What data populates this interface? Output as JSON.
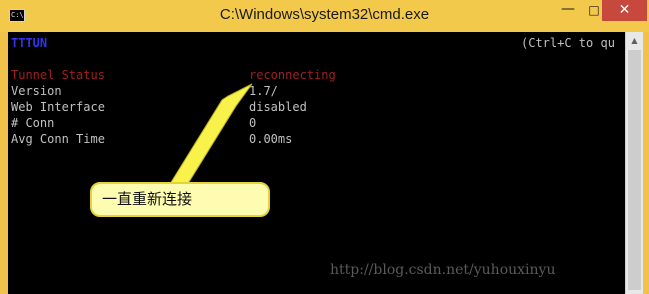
{
  "window": {
    "title": "C:\\Windows\\system32\\cmd.exe",
    "icon_label": "C:\\",
    "controls": {
      "minimize": "—",
      "maximize": "□",
      "close": "✕"
    }
  },
  "console": {
    "header_left": "TTTUN",
    "header_right": "(Ctrl+C to qu",
    "rows": [
      {
        "label": "Tunnel Status",
        "value": "reconnecting"
      },
      {
        "label": "Version",
        "value": "1.7/"
      },
      {
        "label": "Web Interface",
        "value": "disabled"
      },
      {
        "label": "# Conn",
        "value": "0"
      },
      {
        "label": "Avg Conn Time",
        "value": "0.00ms"
      }
    ]
  },
  "annotation": {
    "text": "一直重新连接"
  },
  "watermark": "http://blog.csdn.net/yuhouxinyu",
  "colors": {
    "titlebar": "#f3c94c",
    "console_bg": "#000000",
    "status_red": "#a02020",
    "header_blue": "#3333ee",
    "arrow_yellow": "#f8f24a"
  },
  "icons": [
    "console-app-icon",
    "minimize-icon",
    "maximize-icon",
    "close-icon",
    "scroll-up-arrow-icon"
  ]
}
